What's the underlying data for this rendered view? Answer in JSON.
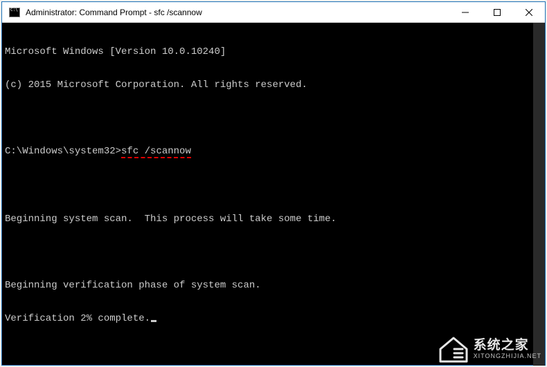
{
  "window": {
    "title": "Administrator: Command Prompt - sfc  /scannow"
  },
  "terminal": {
    "version_line": "Microsoft Windows [Version 10.0.10240]",
    "copyright_line": "(c) 2015 Microsoft Corporation. All rights reserved.",
    "prompt_path": "C:\\Windows\\system32>",
    "typed_command": "sfc /scannow",
    "scan_begin": "Beginning system scan.  This process will take some time.",
    "verify_phase": "Beginning verification phase of system scan.",
    "verify_progress": "Verification 2% complete."
  },
  "watermark": {
    "main": "系统之家",
    "sub": "XITONGZHIJIA.NET"
  }
}
